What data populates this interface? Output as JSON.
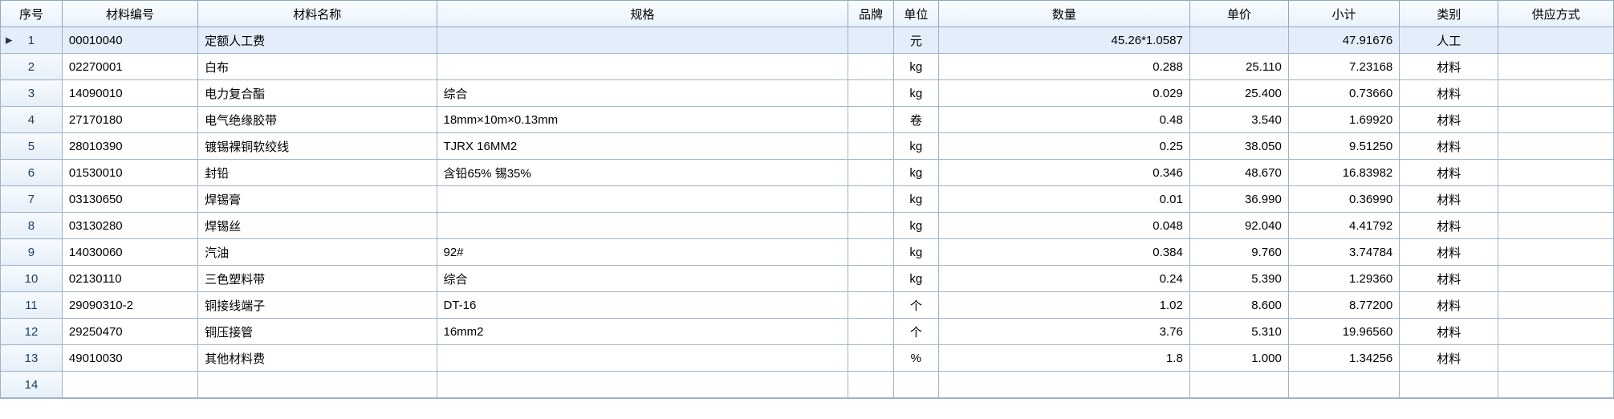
{
  "headers": {
    "seq": "序号",
    "matId": "材料编号",
    "matName": "材料名称",
    "spec": "规格",
    "brand": "品牌",
    "unit": "单位",
    "qty": "数量",
    "price": "单价",
    "subtotal": "小计",
    "category": "类别",
    "supply": "供应方式"
  },
  "selectedRow": 1,
  "rows": [
    {
      "seq": "1",
      "matId": "00010040",
      "matName": "定额人工费",
      "spec": "",
      "brand": "",
      "unit": "元",
      "qty": "45.26*1.0587",
      "price": "",
      "subtotal": "47.91676",
      "category": "人工",
      "supply": ""
    },
    {
      "seq": "2",
      "matId": "02270001",
      "matName": "白布",
      "spec": "",
      "brand": "",
      "unit": "kg",
      "qty": "0.288",
      "price": "25.110",
      "subtotal": "7.23168",
      "category": "材料",
      "supply": ""
    },
    {
      "seq": "3",
      "matId": "14090010",
      "matName": "电力复合酯",
      "spec": "综合",
      "brand": "",
      "unit": "kg",
      "qty": "0.029",
      "price": "25.400",
      "subtotal": "0.73660",
      "category": "材料",
      "supply": ""
    },
    {
      "seq": "4",
      "matId": "27170180",
      "matName": "电气绝缘胶带",
      "spec": "18mm×10m×0.13mm",
      "brand": "",
      "unit": "卷",
      "qty": "0.48",
      "price": "3.540",
      "subtotal": "1.69920",
      "category": "材料",
      "supply": ""
    },
    {
      "seq": "5",
      "matId": "28010390",
      "matName": "镀锡裸铜软绞线",
      "spec": "TJRX 16MM2",
      "brand": "",
      "unit": "kg",
      "qty": "0.25",
      "price": "38.050",
      "subtotal": "9.51250",
      "category": "材料",
      "supply": ""
    },
    {
      "seq": "6",
      "matId": "01530010",
      "matName": "封铅",
      "spec": "含铅65% 锡35%",
      "brand": "",
      "unit": "kg",
      "qty": "0.346",
      "price": "48.670",
      "subtotal": "16.83982",
      "category": "材料",
      "supply": ""
    },
    {
      "seq": "7",
      "matId": "03130650",
      "matName": "焊锡膏",
      "spec": "",
      "brand": "",
      "unit": "kg",
      "qty": "0.01",
      "price": "36.990",
      "subtotal": "0.36990",
      "category": "材料",
      "supply": ""
    },
    {
      "seq": "8",
      "matId": "03130280",
      "matName": "焊锡丝",
      "spec": "",
      "brand": "",
      "unit": "kg",
      "qty": "0.048",
      "price": "92.040",
      "subtotal": "4.41792",
      "category": "材料",
      "supply": ""
    },
    {
      "seq": "9",
      "matId": "14030060",
      "matName": "汽油",
      "spec": "92#",
      "brand": "",
      "unit": "kg",
      "qty": "0.384",
      "price": "9.760",
      "subtotal": "3.74784",
      "category": "材料",
      "supply": ""
    },
    {
      "seq": "10",
      "matId": "02130110",
      "matName": "三色塑料带",
      "spec": "综合",
      "brand": "",
      "unit": "kg",
      "qty": "0.24",
      "price": "5.390",
      "subtotal": "1.29360",
      "category": "材料",
      "supply": ""
    },
    {
      "seq": "11",
      "matId": "29090310-2",
      "matName": "铜接线端子",
      "spec": "DT-16",
      "brand": "",
      "unit": "个",
      "qty": "1.02",
      "price": "8.600",
      "subtotal": "8.77200",
      "category": "材料",
      "supply": ""
    },
    {
      "seq": "12",
      "matId": "29250470",
      "matName": "铜压接管",
      "spec": "16mm2",
      "brand": "",
      "unit": "个",
      "qty": "3.76",
      "price": "5.310",
      "subtotal": "19.96560",
      "category": "材料",
      "supply": ""
    },
    {
      "seq": "13",
      "matId": "49010030",
      "matName": "其他材料费",
      "spec": "",
      "brand": "",
      "unit": "%",
      "qty": "1.8",
      "price": "1.000",
      "subtotal": "1.34256",
      "category": "材料",
      "supply": ""
    },
    {
      "seq": "14",
      "matId": "",
      "matName": "",
      "spec": "",
      "brand": "",
      "unit": "",
      "qty": "",
      "price": "",
      "subtotal": "",
      "category": "",
      "supply": ""
    }
  ],
  "colWidths": {
    "seq": 75,
    "matId": 165,
    "matName": 290,
    "spec": 500,
    "brand": 55,
    "unit": 55,
    "qty": 305,
    "price": 120,
    "subtotal": 135,
    "category": 120,
    "supply": 140
  }
}
